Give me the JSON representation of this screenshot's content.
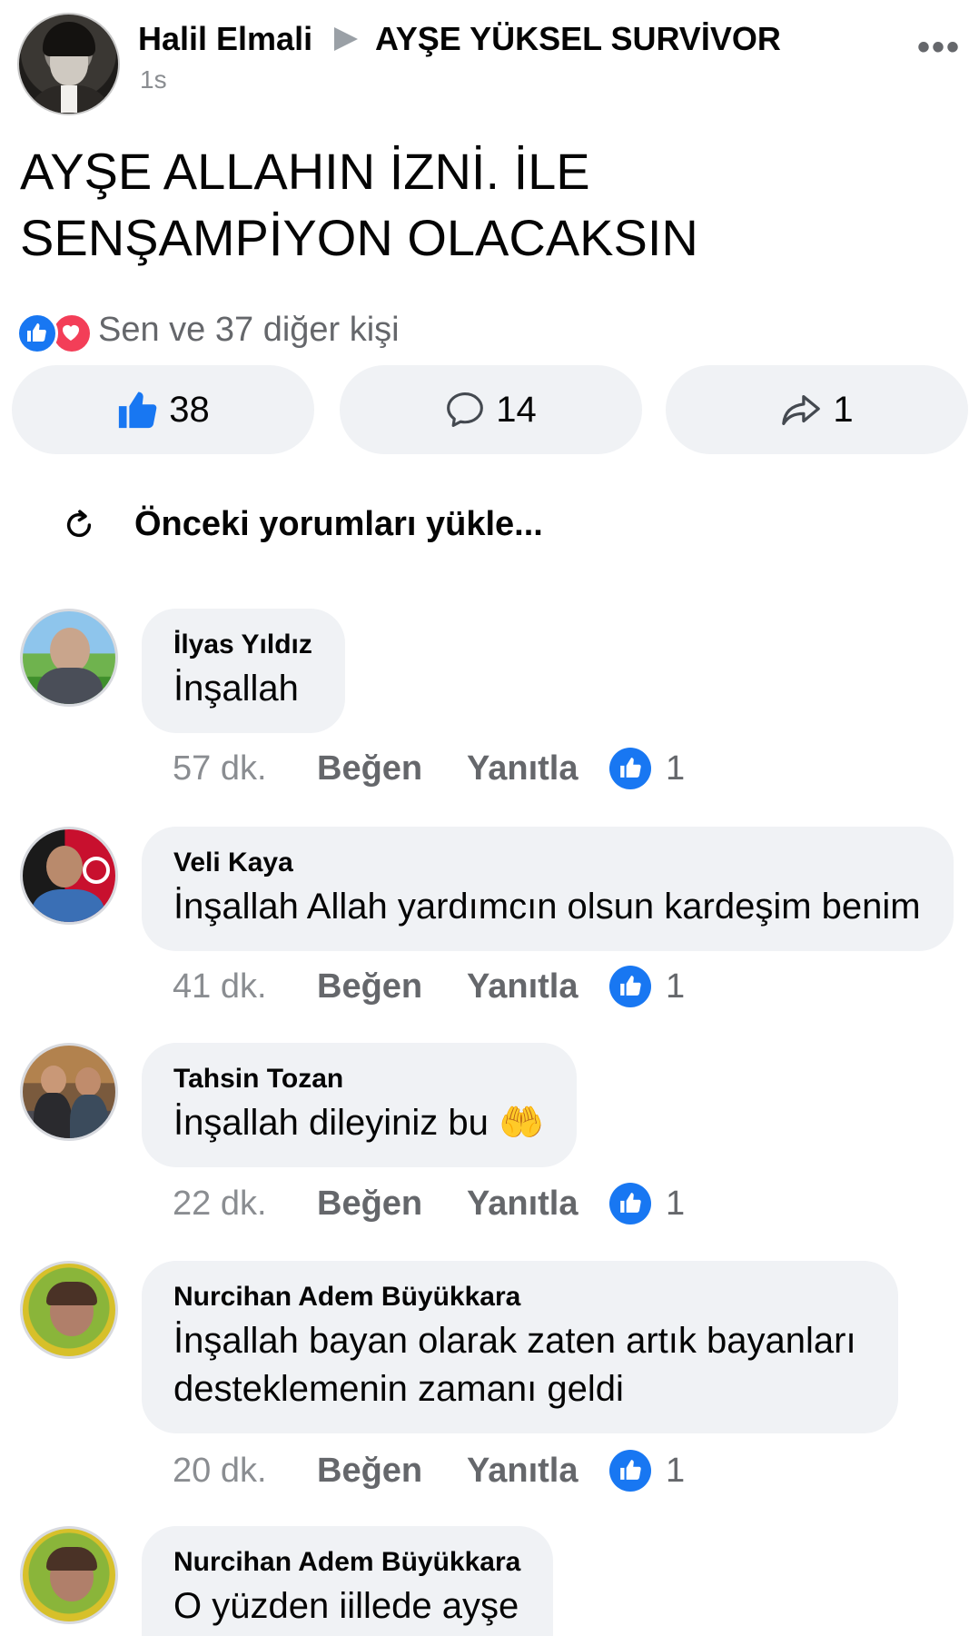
{
  "post": {
    "author": "Halil Elmali",
    "group": "AYŞE YÜKSEL SURVİVOR",
    "time": "1s",
    "more": "•••",
    "text": "AYŞE ALLAHIN  İZNİ. İLE\nSENŞAMPİYON OLACAKSIN",
    "reactions_summary": "Sen ve 37 diğer kişi",
    "like_count": "38",
    "comment_count": "14",
    "share_count": "1",
    "reaction_icons": [
      "like-icon",
      "love-icon"
    ]
  },
  "load_previous": "Önceki yorumları yükle...",
  "actions": {
    "like": "Beğen",
    "reply": "Yanıtla"
  },
  "comments": [
    {
      "name": "İlyas Yıldız",
      "text": "İnşallah",
      "time": "57 dk.",
      "likes": "1"
    },
    {
      "name": "Veli Kaya",
      "text": "İnşallah Allah yardımcın olsun kardeşim benim",
      "time": "41 dk.",
      "likes": "1"
    },
    {
      "name": "Tahsin Tozan",
      "text": "İnşallah dileyiniz bu 🤲",
      "time": "22 dk.",
      "likes": "1"
    },
    {
      "name": "Nurcihan Adem Büyükkara",
      "text": "İnşallah bayan olarak zaten artık bayanları desteklemenin zamanı geldi",
      "time": "20 dk.",
      "likes": "1"
    },
    {
      "name": "Nurcihan Adem Büyükkara",
      "text": "O yüzden iillede ayşe",
      "time": "",
      "likes": ""
    }
  ],
  "colors": {
    "accent": "#1877f2",
    "love": "#f33e58",
    "bubble": "#f0f2f5",
    "muted": "#65676b"
  }
}
